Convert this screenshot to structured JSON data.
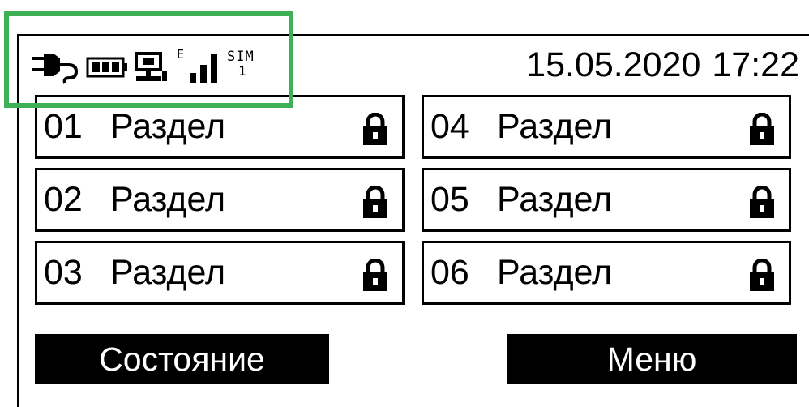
{
  "status_bar": {
    "icons": [
      "power-plug-icon",
      "battery-icon",
      "ethernet-icon",
      "signal-icon",
      "sim-icon"
    ],
    "network_type": "E",
    "sim_label": "SIM",
    "sim_number": "1",
    "date": "15.05.2020",
    "time": "17:22"
  },
  "sections": [
    {
      "number": "01",
      "label": "Раздел",
      "icon": "lock-icon"
    },
    {
      "number": "02",
      "label": "Раздел",
      "icon": "lock-icon"
    },
    {
      "number": "03",
      "label": "Раздел",
      "icon": "lock-icon"
    },
    {
      "number": "04",
      "label": "Раздел",
      "icon": "lock-icon"
    },
    {
      "number": "05",
      "label": "Раздел",
      "icon": "lock-icon"
    },
    {
      "number": "06",
      "label": "Раздел",
      "icon": "lock-icon"
    }
  ],
  "buttons": {
    "state_label": "Состояние",
    "menu_label": "Меню"
  },
  "colors": {
    "highlight": "#3eb055",
    "foreground": "#000000",
    "background": "#ffffff"
  }
}
